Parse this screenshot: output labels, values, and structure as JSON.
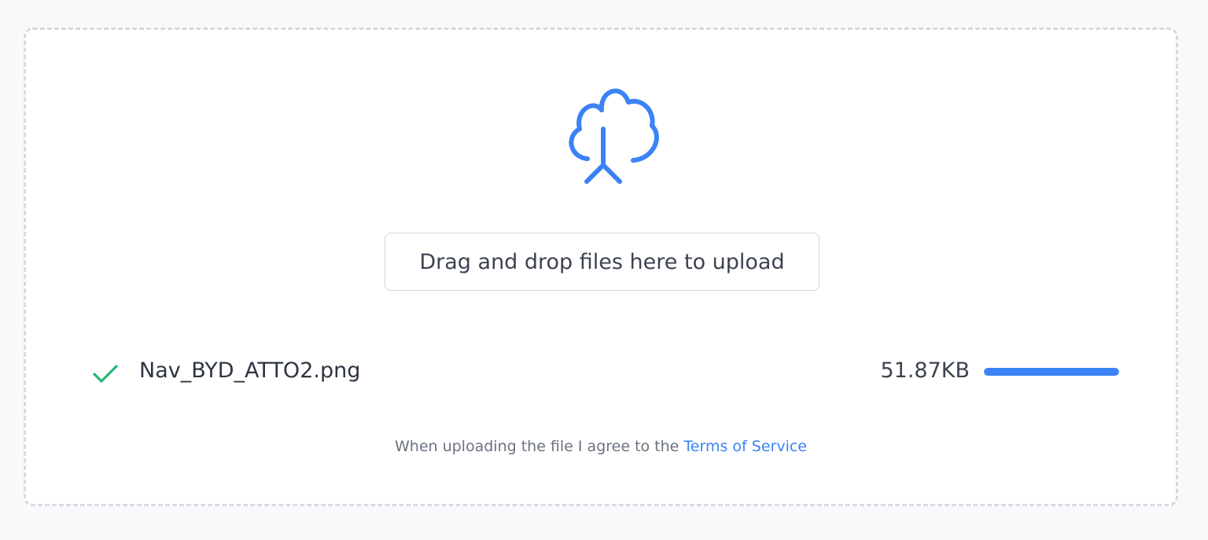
{
  "dropzone": {
    "icon": "cloud-upload-icon",
    "button_label": "Drag and drop files here to upload"
  },
  "file": {
    "status_icon": "check-icon",
    "name": "Nav_BYD_ATTO2.png",
    "size": "51.87KB",
    "progress_percent": 100
  },
  "terms": {
    "text": "When uploading the file I agree to the",
    "link_label": "Terms of Service"
  },
  "colors": {
    "accent": "#3b82f6",
    "success": "#22b573",
    "border": "#d7dadf",
    "background": "#f8f9fb"
  }
}
